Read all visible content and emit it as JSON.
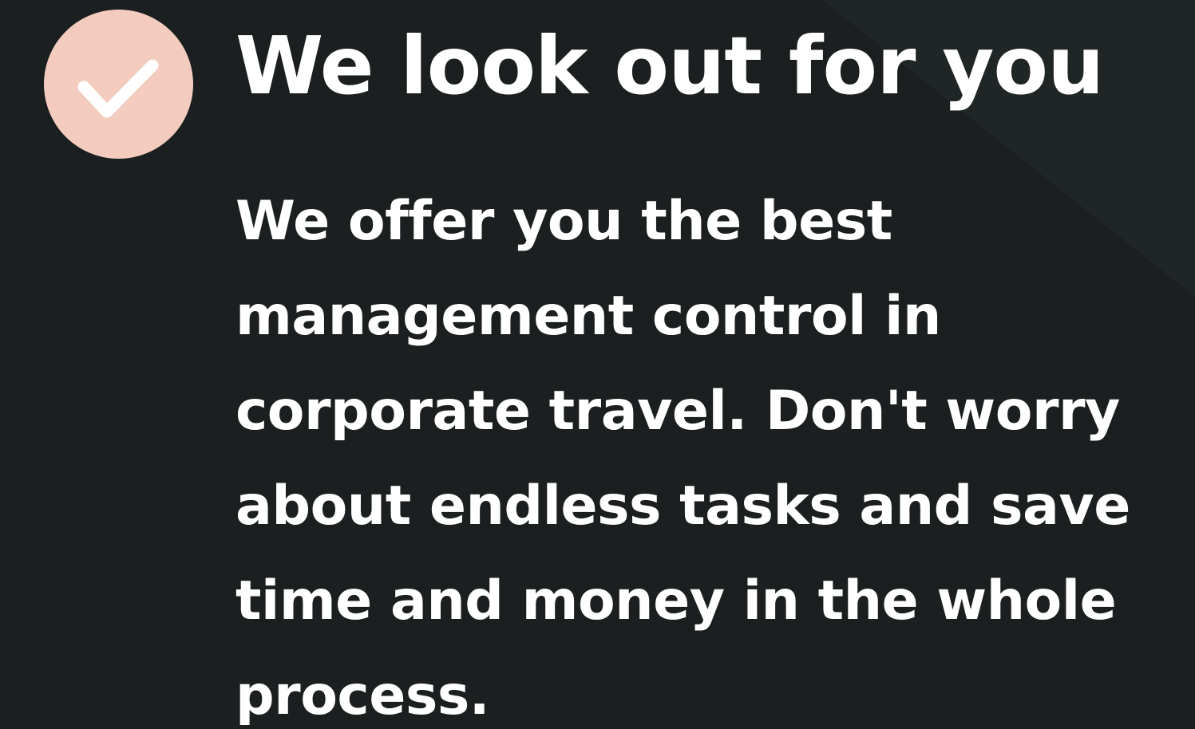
{
  "feature": {
    "icon": "checkmark-icon",
    "title": "We look out for you",
    "body": "We offer you the best\nmanagement control in\ncorporate travel.  Don't worry\nabout endless tasks and save\ntime and money in the whole\nprocess."
  },
  "colors": {
    "background": "#1b1f20",
    "badge": "#f3ccbf",
    "text": "#ffffff"
  }
}
